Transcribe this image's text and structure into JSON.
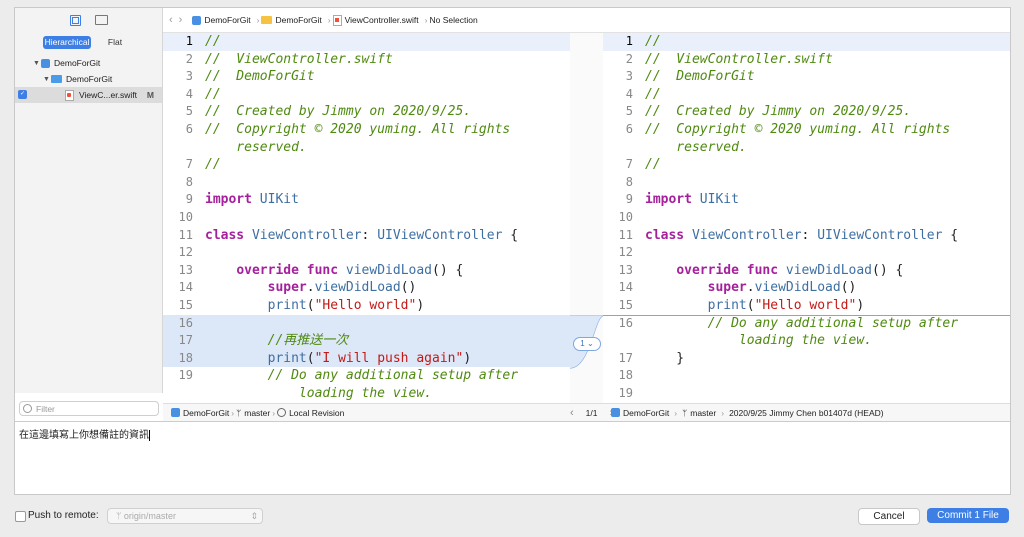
{
  "sidebar": {
    "tab_hierarchical": "Hierarchical",
    "tab_flat": "Flat",
    "tree": [
      {
        "label": "DemoForGit",
        "icon": "project-icon"
      },
      {
        "label": "DemoForGit",
        "icon": "folder-icon"
      },
      {
        "label": "ViewC...er.swift",
        "icon": "swift-file-icon",
        "badge": "M"
      }
    ],
    "filter_placeholder": "Filter"
  },
  "jumpbar": {
    "crumbs": [
      "DemoForGit",
      "DemoForGit",
      "ViewController.swift",
      "No Selection"
    ]
  },
  "left_pane": {
    "lines": [
      {
        "n": "1",
        "t": "//"
      },
      {
        "n": "2",
        "t": "//  ViewController.swift"
      },
      {
        "n": "3",
        "t": "//  DemoForGit"
      },
      {
        "n": "4",
        "t": "//"
      },
      {
        "n": "5",
        "t": "//  Created by Jimmy on 2020/9/25."
      },
      {
        "n": "6",
        "t": "//  Copyright © 2020 yuming. All rights"
      },
      {
        "n": "",
        "t": "    reserved."
      },
      {
        "n": "7",
        "t": "//"
      },
      {
        "n": "8",
        "t": ""
      },
      {
        "n": "9",
        "t": "import UIKit"
      },
      {
        "n": "10",
        "t": ""
      },
      {
        "n": "11",
        "t": "class ViewController: UIViewController {"
      },
      {
        "n": "12",
        "t": ""
      },
      {
        "n": "13",
        "t": "    override func viewDidLoad() {"
      },
      {
        "n": "14",
        "t": "        super.viewDidLoad()"
      },
      {
        "n": "15",
        "t": "        print(\"Hello world\")"
      },
      {
        "n": "16",
        "t": ""
      },
      {
        "n": "17",
        "t": "        //再推送一次"
      },
      {
        "n": "18",
        "t": "        print(\"I will push again\")"
      },
      {
        "n": "19",
        "t": "        // Do any additional setup after"
      },
      {
        "n": "",
        "t": "            loading the view."
      }
    ]
  },
  "right_pane": {
    "lines": [
      {
        "n": "1",
        "t": "//"
      },
      {
        "n": "2",
        "t": "//  ViewController.swift"
      },
      {
        "n": "3",
        "t": "//  DemoForGit"
      },
      {
        "n": "4",
        "t": "//"
      },
      {
        "n": "5",
        "t": "//  Created by Jimmy on 2020/9/25."
      },
      {
        "n": "6",
        "t": "//  Copyright © 2020 yuming. All rights"
      },
      {
        "n": "",
        "t": "    reserved."
      },
      {
        "n": "7",
        "t": "//"
      },
      {
        "n": "8",
        "t": ""
      },
      {
        "n": "9",
        "t": "import UIKit"
      },
      {
        "n": "10",
        "t": ""
      },
      {
        "n": "11",
        "t": "class ViewController: UIViewController {"
      },
      {
        "n": "12",
        "t": ""
      },
      {
        "n": "13",
        "t": "    override func viewDidLoad() {"
      },
      {
        "n": "14",
        "t": "        super.viewDidLoad()"
      },
      {
        "n": "15",
        "t": "        print(\"Hello world\")"
      },
      {
        "n": "16",
        "t": "        // Do any additional setup after"
      },
      {
        "n": "",
        "t": "            loading the view."
      },
      {
        "n": "17",
        "t": "    }"
      },
      {
        "n": "18",
        "t": ""
      },
      {
        "n": "19",
        "t": ""
      }
    ]
  },
  "diff_badge": "1",
  "status_left": {
    "repo": "DemoForGit",
    "branch": "master",
    "revision": "Local Revision"
  },
  "status_center": "1/1",
  "status_right": {
    "repo": "DemoForGit",
    "branch": "master",
    "revision": "2020/9/25  Jimmy Chen  b01407d (HEAD)"
  },
  "commit_message": "在這邊填寫上你想備註的資訊",
  "footer": {
    "push_label": "Push to remote:",
    "remote_value": "origin/master",
    "cancel_label": "Cancel",
    "commit_label": "Commit 1 File"
  },
  "colors": {
    "accent": "#3d7fe5",
    "diff_highlight": "#dce7f8",
    "comment": "#4f8a10",
    "keyword": "#a5219c",
    "string": "#c41a16",
    "type": "#3e6fa3"
  }
}
